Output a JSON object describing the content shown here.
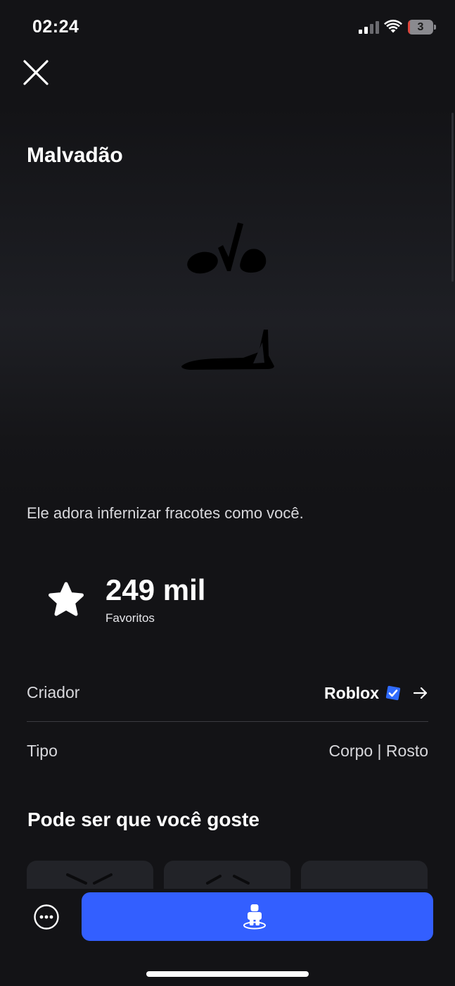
{
  "status_bar": {
    "time": "02:24",
    "battery_level": "3"
  },
  "item": {
    "title": "Malvadão",
    "description": "Ele adora infernizar fracotes como você."
  },
  "favorites": {
    "count": "249 mil",
    "label": "Favoritos"
  },
  "details": {
    "creator_label": "Criador",
    "creator_name": "Roblox",
    "type_label": "Tipo",
    "type_value": "Corpo | Rosto"
  },
  "recommendations": {
    "title": "Pode ser que você goste"
  },
  "colors": {
    "background": "#131316",
    "accent": "#335fff",
    "verified": "#2f6bff"
  },
  "icons": [
    "close-icon",
    "star-icon",
    "verified-icon",
    "arrow-right-icon",
    "more-icon",
    "avatar-try-on-icon"
  ]
}
